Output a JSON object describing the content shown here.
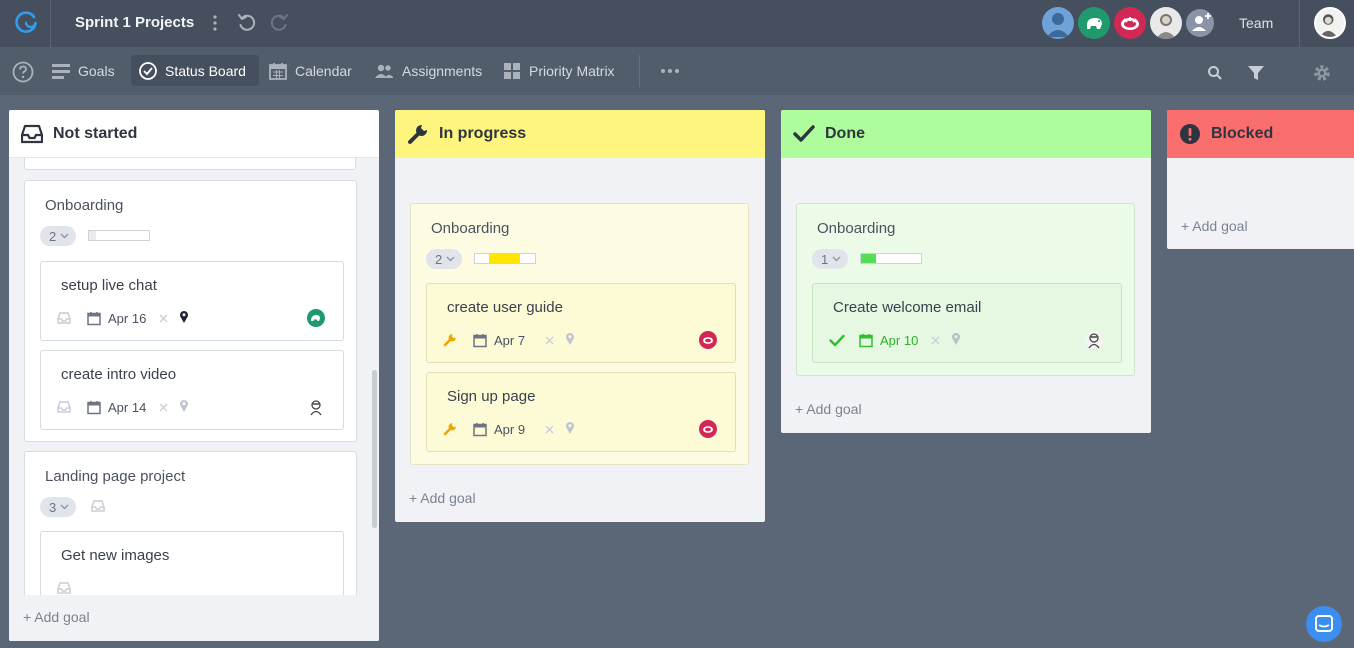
{
  "app": {
    "project_title": "Sprint 1 Projects",
    "team_label": "Team"
  },
  "icons": {
    "logo": "refresh-logo-icon",
    "menu": "kebab-menu-icon",
    "undo": "undo-icon",
    "redo": "redo-icon",
    "add_member": "add-member-icon"
  },
  "nav": {
    "tabs": [
      {
        "label": "Goals",
        "icon": "list-icon",
        "active": false
      },
      {
        "label": "Status Board",
        "icon": "check-circle-icon",
        "active": true
      },
      {
        "label": "Calendar",
        "icon": "calendar-icon",
        "active": false
      },
      {
        "label": "Assignments",
        "icon": "people-icon",
        "active": false
      },
      {
        "label": "Priority Matrix",
        "icon": "grid-icon",
        "active": false
      }
    ]
  },
  "colors": {
    "not_started_head": "#ffffff",
    "in_progress_head": "#fdf57e",
    "done_head": "#aefc9c",
    "blocked_head": "#fb6e6e",
    "progress_yellow": "#ffe500",
    "progress_green": "#55dd55",
    "accent_blue": "#2f9ef0"
  },
  "columns": {
    "not_started": {
      "title": "Not started",
      "add_goal": "+ Add goal",
      "groups": [
        {
          "title": "Onboarding",
          "count": "2",
          "progress": 0.1,
          "cards": [
            {
              "title": "setup live chat",
              "date": "Apr 16",
              "assignee": "green-creature-avatar"
            },
            {
              "title": "create intro video",
              "date": "Apr 14",
              "assignee": "sketch-portrait-avatar"
            }
          ]
        },
        {
          "title": "Landing page project",
          "count": "3",
          "cards": [
            {
              "title": "Get new images"
            }
          ]
        }
      ]
    },
    "in_progress": {
      "title": "In progress",
      "add_goal": "+ Add goal",
      "groups": [
        {
          "title": "Onboarding",
          "count": "2",
          "progress": 0.5,
          "cards": [
            {
              "title": "create user guide",
              "date": "Apr 7",
              "assignee": "red-creature-avatar"
            },
            {
              "title": "Sign up page",
              "date": "Apr 9",
              "assignee": "red-creature-avatar"
            }
          ]
        }
      ]
    },
    "done": {
      "title": "Done",
      "add_goal": "+ Add goal",
      "groups": [
        {
          "title": "Onboarding",
          "count": "1",
          "progress": 0.25,
          "cards": [
            {
              "title": "Create welcome email",
              "date": "Apr 10",
              "assignee": "sketch-portrait-avatar"
            }
          ]
        }
      ]
    },
    "blocked": {
      "title": "Blocked",
      "add_goal": "+ Add goal"
    }
  }
}
